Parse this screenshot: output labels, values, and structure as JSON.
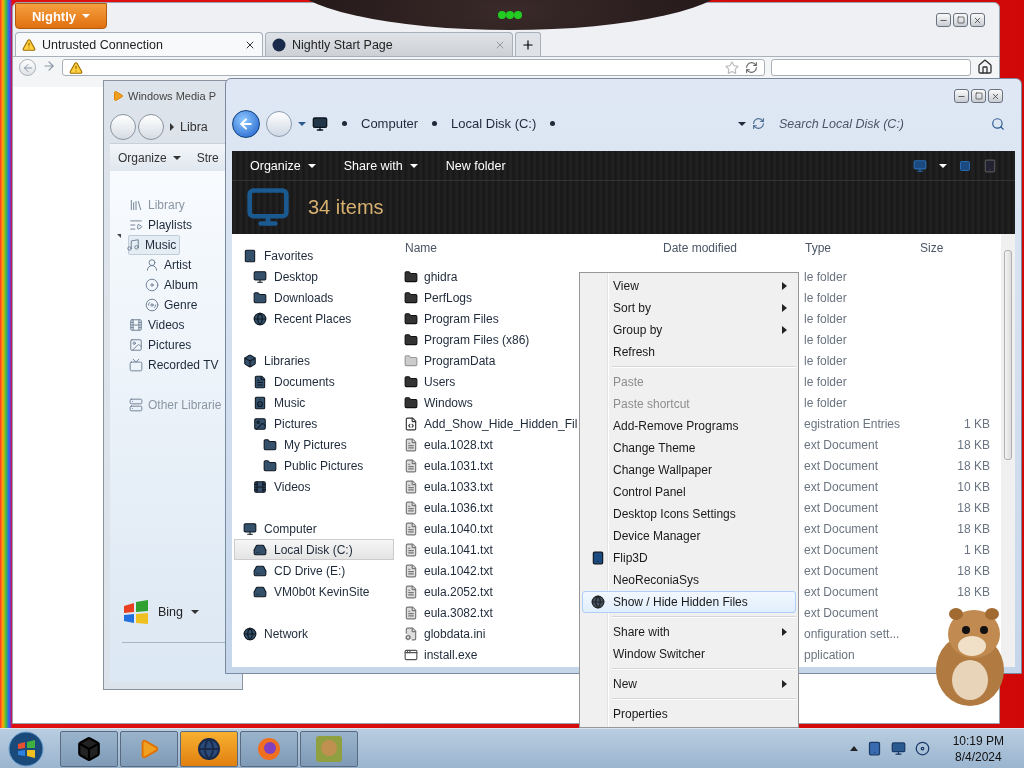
{
  "browser": {
    "menu_button": "Nightly",
    "tabs": [
      {
        "label": "Untrusted Connection",
        "selected": true
      },
      {
        "label": "Nightly Start Page",
        "selected": false
      }
    ]
  },
  "media_player": {
    "title": "Windows Media P",
    "breadcrumb": "Libra",
    "toolbar": [
      "Organize",
      "Stre"
    ],
    "nav": [
      {
        "label": "Library",
        "kind": "library",
        "disabled": true,
        "selected": false
      },
      {
        "label": "Playlists",
        "kind": "playlist",
        "disabled": false,
        "selected": false
      },
      {
        "label": "Music",
        "kind": "music",
        "disabled": false,
        "selected": true,
        "expanded": true,
        "children": [
          {
            "label": "Artist",
            "kind": "artist",
            "disabled": false,
            "selected": false
          },
          {
            "label": "Album",
            "kind": "album",
            "disabled": false,
            "selected": false
          },
          {
            "label": "Genre",
            "kind": "genre",
            "disabled": false,
            "selected": false
          }
        ]
      },
      {
        "label": "Videos",
        "kind": "video",
        "disabled": false,
        "selected": false
      },
      {
        "label": "Pictures",
        "kind": "picture",
        "disabled": false,
        "selected": false
      },
      {
        "label": "Recorded TV",
        "kind": "tv",
        "disabled": false,
        "selected": false
      },
      {
        "label": "Other Librarie",
        "kind": "server",
        "disabled": true,
        "selected": false
      }
    ],
    "search_provider": "Bing"
  },
  "explorer": {
    "breadcrumb": [
      "Computer",
      "Local Disk (C:)"
    ],
    "search": {
      "placeholder": "Search Local Disk (C:)"
    },
    "toolbar": [
      "Organize",
      "Share with",
      "New folder"
    ],
    "item_count": "34 items",
    "nav": [
      {
        "label": "Favorites",
        "kind": "tablet",
        "selected": false,
        "children": [
          {
            "label": "Desktop",
            "kind": "monitor",
            "selected": false
          },
          {
            "label": "Downloads",
            "kind": "folder",
            "selected": false
          },
          {
            "label": "Recent Places",
            "kind": "globe",
            "selected": false
          }
        ]
      },
      {
        "label": "Libraries",
        "kind": "box",
        "selected": false,
        "children": [
          {
            "label": "Documents",
            "kind": "document",
            "selected": false
          },
          {
            "label": "Music",
            "kind": "speaker",
            "selected": false
          },
          {
            "label": "Pictures",
            "kind": "picture",
            "selected": false,
            "children": [
              {
                "label": "My Pictures",
                "kind": "folder",
                "selected": false
              },
              {
                "label": "Public Pictures",
                "kind": "folder",
                "selected": false
              }
            ]
          },
          {
            "label": "Videos",
            "kind": "film",
            "selected": false
          }
        ]
      },
      {
        "label": "Computer",
        "kind": "monitor",
        "selected": false,
        "children": [
          {
            "label": "Local Disk (C:)",
            "kind": "drive",
            "selected": true
          },
          {
            "label": "CD Drive (E:)",
            "kind": "drive",
            "selected": false
          },
          {
            "label": "VM0b0t KevinSite",
            "kind": "drive",
            "selected": false
          }
        ]
      },
      {
        "label": "Network",
        "kind": "globe",
        "selected": false
      }
    ],
    "columns": [
      "Name",
      "Date modified",
      "Type",
      "Size"
    ],
    "rows": [
      {
        "name": "ghidra",
        "kind": "folder",
        "type": "le folder"
      },
      {
        "name": "PerfLogs",
        "kind": "folder",
        "type": "le folder"
      },
      {
        "name": "Program Files",
        "kind": "folder",
        "type": "le folder"
      },
      {
        "name": "Program Files (x86)",
        "kind": "folder",
        "type": "le folder"
      },
      {
        "name": "ProgramData",
        "kind": "hidden-folder",
        "type": "le folder"
      },
      {
        "name": "Users",
        "kind": "folder",
        "type": "le folder"
      },
      {
        "name": "Windows",
        "kind": "folder",
        "type": "le folder"
      },
      {
        "name": "Add_Show_Hide_Hidden_Fil",
        "kind": "registry",
        "type": "egistration Entries",
        "size": "1 KB"
      },
      {
        "name": "eula.1028.txt",
        "kind": "text",
        "type": "ext Document",
        "size": "18 KB"
      },
      {
        "name": "eula.1031.txt",
        "kind": "text",
        "type": "ext Document",
        "size": "18 KB"
      },
      {
        "name": "eula.1033.txt",
        "kind": "text",
        "type": "ext Document",
        "size": "10 KB"
      },
      {
        "name": "eula.1036.txt",
        "kind": "text",
        "type": "ext Document",
        "size": "18 KB"
      },
      {
        "name": "eula.1040.txt",
        "kind": "text",
        "type": "ext Document",
        "size": "18 KB"
      },
      {
        "name": "eula.1041.txt",
        "kind": "text",
        "type": "ext Document",
        "size": "1 KB"
      },
      {
        "name": "eula.1042.txt",
        "kind": "text",
        "type": "ext Document",
        "size": "18 KB"
      },
      {
        "name": "eula.2052.txt",
        "kind": "text",
        "type": "ext Document",
        "size": "18 KB"
      },
      {
        "name": "eula.3082.txt",
        "kind": "text",
        "type": "ext Document"
      },
      {
        "name": "globdata.ini",
        "kind": "settings",
        "type": "onfiguration sett..."
      },
      {
        "name": "install.exe",
        "kind": "application",
        "type": "pplication"
      }
    ]
  },
  "context_menu": {
    "groups": [
      {
        "items": [
          {
            "label": "View",
            "submenu": true,
            "disabled": false,
            "highlighted": false
          },
          {
            "label": "Sort by",
            "submenu": true,
            "disabled": false,
            "highlighted": false
          },
          {
            "label": "Group by",
            "submenu": true,
            "disabled": false,
            "highlighted": false
          },
          {
            "label": "Refresh",
            "submenu": false,
            "disabled": false,
            "highlighted": false
          }
        ]
      },
      {
        "items": [
          {
            "label": "Paste",
            "submenu": false,
            "disabled": true,
            "highlighted": false
          },
          {
            "label": "Paste shortcut",
            "submenu": false,
            "disabled": true,
            "highlighted": false
          },
          {
            "label": "Add-Remove Programs",
            "submenu": false,
            "disabled": false,
            "highlighted": false
          },
          {
            "label": "Change Theme",
            "submenu": false,
            "disabled": false,
            "highlighted": false
          },
          {
            "label": "Change Wallpaper",
            "submenu": false,
            "disabled": false,
            "highlighted": false
          },
          {
            "label": "Control Panel",
            "submenu": false,
            "disabled": false,
            "highlighted": false
          },
          {
            "label": "Desktop Icons Settings",
            "submenu": false,
            "disabled": false,
            "highlighted": false
          },
          {
            "label": "Device Manager",
            "submenu": false,
            "disabled": false,
            "highlighted": false
          },
          {
            "label": "Flip3D",
            "kind": "tablet",
            "submenu": false,
            "disabled": false,
            "highlighted": false
          },
          {
            "label": "NeoReconiaSys",
            "submenu": false,
            "disabled": false,
            "highlighted": false
          },
          {
            "label": "Show / Hide Hidden Files",
            "kind": "globe",
            "submenu": false,
            "disabled": false,
            "highlighted": true
          }
        ]
      },
      {
        "items": [
          {
            "label": "Share with",
            "submenu": true,
            "disabled": false,
            "highlighted": false
          },
          {
            "label": "Window Switcher",
            "submenu": false,
            "disabled": false,
            "highlighted": false
          }
        ]
      },
      {
        "items": [
          {
            "label": "New",
            "submenu": true,
            "disabled": false,
            "highlighted": false
          }
        ]
      },
      {
        "items": [
          {
            "label": "Properties",
            "submenu": false,
            "disabled": false,
            "highlighted": false
          }
        ]
      }
    ]
  },
  "taskbar": {
    "clock": {
      "time": "10:19 PM",
      "date": "8/4/2024"
    }
  }
}
